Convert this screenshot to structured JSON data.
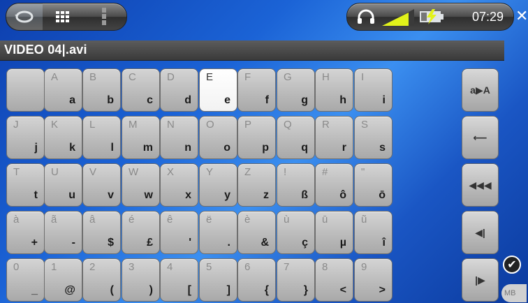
{
  "status": {
    "time": "07:29"
  },
  "filename": "VIDEO 04|.avi",
  "keys": [
    [
      {
        "s": "",
        "m": ""
      },
      {
        "s": "A",
        "m": "a"
      },
      {
        "s": "B",
        "m": "b"
      },
      {
        "s": "C",
        "m": "c"
      },
      {
        "s": "D",
        "m": "d"
      },
      {
        "s": "E",
        "m": "e"
      },
      {
        "s": "F",
        "m": "f"
      },
      {
        "s": "G",
        "m": "g"
      },
      {
        "s": "H",
        "m": "h"
      },
      {
        "s": "I",
        "m": "i"
      }
    ],
    [
      {
        "s": "J",
        "m": "j"
      },
      {
        "s": "K",
        "m": "k"
      },
      {
        "s": "L",
        "m": "l"
      },
      {
        "s": "M",
        "m": "m"
      },
      {
        "s": "N",
        "m": "n"
      },
      {
        "s": "O",
        "m": "o"
      },
      {
        "s": "P",
        "m": "p"
      },
      {
        "s": "Q",
        "m": "q"
      },
      {
        "s": "R",
        "m": "r"
      },
      {
        "s": "S",
        "m": "s"
      }
    ],
    [
      {
        "s": "T",
        "m": "t"
      },
      {
        "s": "U",
        "m": "u"
      },
      {
        "s": "V",
        "m": "v"
      },
      {
        "s": "W",
        "m": "w"
      },
      {
        "s": "X",
        "m": "x"
      },
      {
        "s": "Y",
        "m": "y"
      },
      {
        "s": "Z",
        "m": "z"
      },
      {
        "s": "!",
        "m": "ß"
      },
      {
        "s": "#",
        "m": "ô"
      },
      {
        "s": "\"",
        "m": "ō"
      }
    ],
    [
      {
        "s": "à",
        "m": "+"
      },
      {
        "s": "ã",
        "m": "-"
      },
      {
        "s": "â",
        "m": "$"
      },
      {
        "s": "é",
        "m": "£"
      },
      {
        "s": "ê",
        "m": "'"
      },
      {
        "s": "ë",
        "m": "."
      },
      {
        "s": "è",
        "m": "&"
      },
      {
        "s": "ù",
        "m": "ç"
      },
      {
        "s": "ū",
        "m": "µ"
      },
      {
        "s": "ũ",
        "m": "î"
      }
    ],
    [
      {
        "s": "0",
        "m": "_"
      },
      {
        "s": "1",
        "m": "@"
      },
      {
        "s": "2",
        "m": "("
      },
      {
        "s": "3",
        "m": ")"
      },
      {
        "s": "4",
        "m": "["
      },
      {
        "s": "5",
        "m": "]"
      },
      {
        "s": "6",
        "m": "{"
      },
      {
        "s": "7",
        "m": "}"
      },
      {
        "s": "8",
        "m": "<"
      },
      {
        "s": "9",
        "m": ">"
      }
    ]
  ],
  "side_keys": [
    "a▶A",
    "⟵",
    "◀◀◀",
    "◀|",
    "|▶"
  ],
  "mode_label": "MB"
}
